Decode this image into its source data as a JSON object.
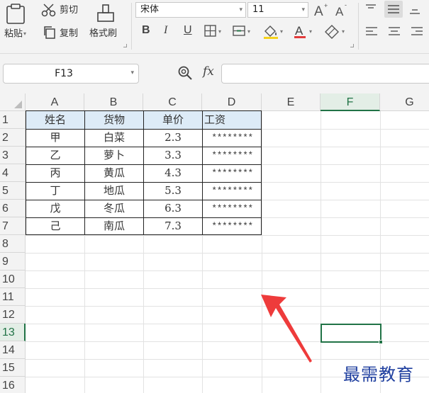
{
  "ribbon": {
    "cut_label": "剪切",
    "paste_label": "粘贴",
    "copy_label": "复制",
    "format_painter_label": "格式刷",
    "font_name": "宋体",
    "font_size": "11",
    "bold": "B",
    "italic": "I",
    "underline": "U",
    "font_color_glyph": "A"
  },
  "formula_bar": {
    "name_box": "F13",
    "fx": "fx",
    "formula": ""
  },
  "sheet": {
    "columns": [
      "A",
      "B",
      "C",
      "D",
      "E",
      "F",
      "G"
    ],
    "selected_column": "F",
    "rows": [
      "1",
      "2",
      "3",
      "4",
      "5",
      "6",
      "7",
      "8",
      "9",
      "10",
      "11",
      "12",
      "13",
      "14",
      "15",
      "16"
    ],
    "selected_row": "13",
    "table": {
      "headers": [
        "姓名",
        "货物",
        "单价",
        "工资"
      ],
      "rows": [
        [
          "甲",
          "白菜",
          "2.3",
          "********"
        ],
        [
          "乙",
          "萝卜",
          "3.3",
          "********"
        ],
        [
          "丙",
          "黄瓜",
          "4.3",
          "********"
        ],
        [
          "丁",
          "地瓜",
          "5.3",
          "********"
        ],
        [
          "戊",
          "冬瓜",
          "6.3",
          "********"
        ],
        [
          "己",
          "南瓜",
          "7.3",
          "********"
        ]
      ]
    }
  },
  "watermark": "最需教育",
  "colors": {
    "accent": "#217346",
    "header_fill": "#ddebf7",
    "arrow": "#ee3b3b",
    "watermark": "#1f3f9f"
  }
}
